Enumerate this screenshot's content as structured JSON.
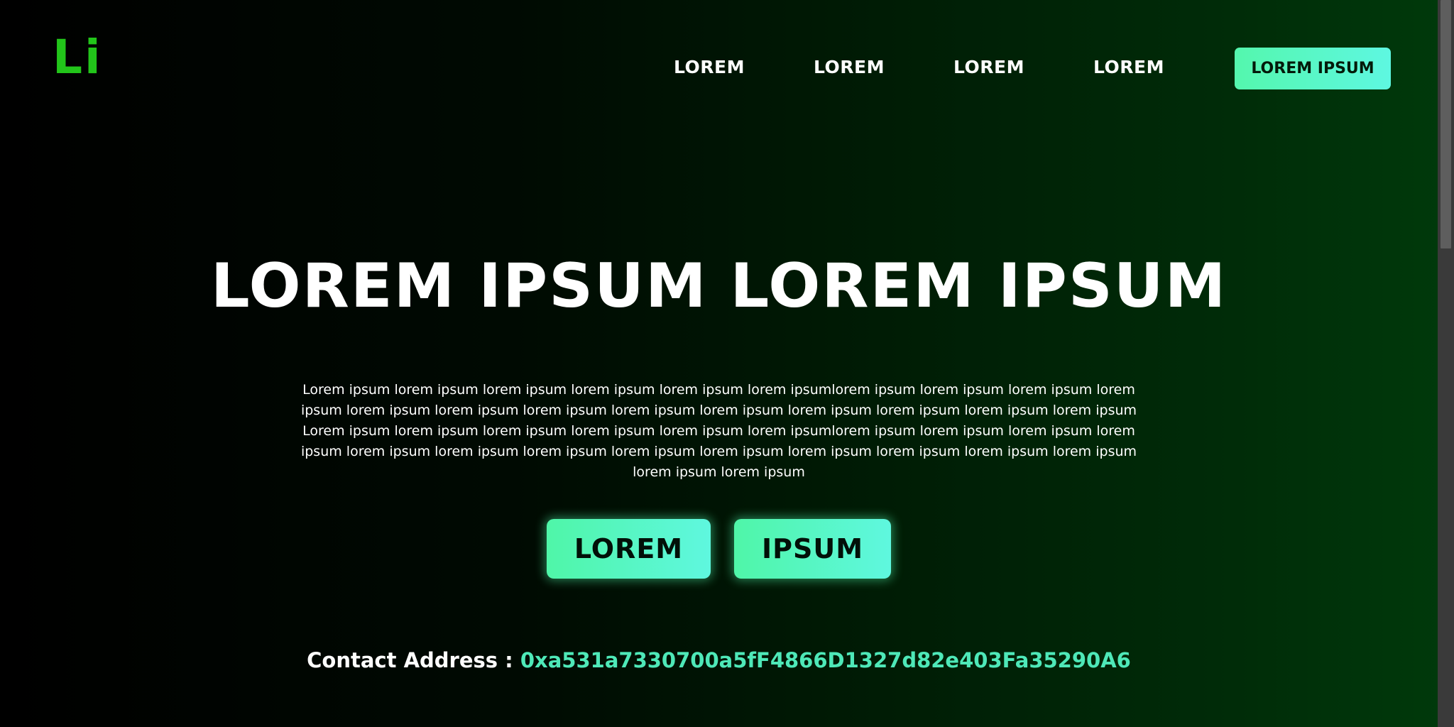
{
  "header": {
    "logo_text": "Li",
    "nav": [
      {
        "label": "LOREM"
      },
      {
        "label": "LOREM"
      },
      {
        "label": "LOREM"
      },
      {
        "label": "LOREM"
      }
    ],
    "cta_label": "LOREM IPSUM"
  },
  "hero": {
    "headline": "LOREM IPSUM LOREM IPSUM",
    "body": "Lorem ipsum lorem ipsum lorem ipsum lorem ipsum lorem ipsum lorem ipsumlorem ipsum lorem ipsum lorem ipsum lorem ipsum lorem ipsum lorem ipsum lorem ipsum lorem ipsum lorem ipsum lorem ipsum lorem ipsum lorem ipsum lorem ipsum Lorem ipsum lorem ipsum lorem ipsum lorem ipsum lorem ipsum lorem ipsumlorem ipsum lorem ipsum lorem ipsum lorem ipsum lorem ipsum lorem ipsum lorem ipsum lorem ipsum lorem ipsum lorem ipsum lorem ipsum lorem ipsum lorem ipsum lorem ipsum lorem ipsum",
    "buttons": [
      {
        "label": "LOREM"
      },
      {
        "label": "IPSUM"
      }
    ]
  },
  "contact": {
    "label": "Contact Address :",
    "value": "0xa531a7330700a5fF4866D1327d82e403Fa35290A6"
  },
  "colors": {
    "logo": "#22c51a",
    "accent_gradient_start": "#54f7ad",
    "accent_gradient_end": "#5ef7e1",
    "address": "#4ee8b8"
  }
}
